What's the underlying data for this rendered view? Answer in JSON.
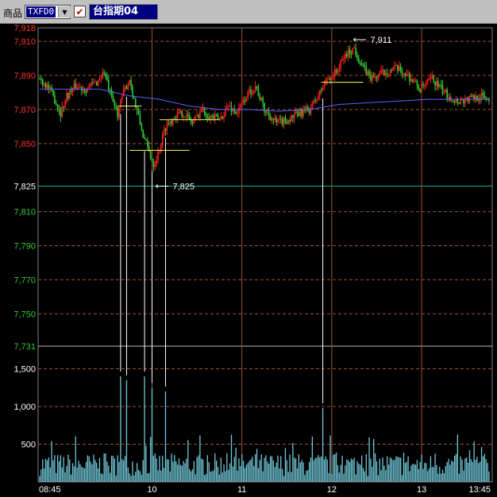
{
  "toolbar": {
    "product_label": "商品",
    "product_code": "TXFD0",
    "dropdown_glyph": "▼",
    "check_glyph": "✔",
    "instrument_name": "台指期04"
  },
  "colors": {
    "background": "#000000",
    "grid": "#a0522d",
    "up": "#ff2020",
    "down": "#33cc33",
    "avg_line": "#6060ff",
    "volume": "#70c8d8",
    "price_tick_upper": "#ff3030",
    "price_tick_lower": "#33cc33",
    "neutral_tick": "#ffffff",
    "annotation": "#ffffff",
    "yellow_marks": "#ffff66"
  },
  "chart_data": {
    "type": "candlestick_with_volume",
    "x_tick_labels": [
      "08:45",
      "10",
      "11",
      "12",
      "13",
      "13:45"
    ],
    "price_axis": {
      "ylim": [
        7731,
        7918
      ],
      "ticks": [
        {
          "value": 7918,
          "label": "7,918",
          "color": "up"
        },
        {
          "value": 7910,
          "label": "7,910",
          "color": "up"
        },
        {
          "value": 7890,
          "label": "7,890",
          "color": "up"
        },
        {
          "value": 7870,
          "label": "7,870",
          "color": "up"
        },
        {
          "value": 7850,
          "label": "7,850",
          "color": "up"
        },
        {
          "value": 7825,
          "label": "7,825",
          "color": "neutral"
        },
        {
          "value": 7810,
          "label": "7,810",
          "color": "down"
        },
        {
          "value": 7790,
          "label": "7,790",
          "color": "down"
        },
        {
          "value": 7770,
          "label": "7,770",
          "color": "down"
        },
        {
          "value": 7750,
          "label": "7,750",
          "color": "down"
        },
        {
          "value": 7731,
          "label": "7,731",
          "color": "down"
        }
      ],
      "reference_price": 7825
    },
    "volume_axis": {
      "ylim": [
        0,
        1800
      ],
      "ticks": [
        {
          "value": 1500,
          "label": "1,500"
        },
        {
          "value": 1000,
          "label": "1,000"
        },
        {
          "value": 500,
          "label": "500"
        }
      ]
    },
    "annotations": [
      {
        "label": "7,911",
        "value": 7911,
        "time_min": 207
      },
      {
        "label": "7,825",
        "value": 7825,
        "time_min": 75
      }
    ],
    "session_minutes": 300,
    "price_anchors": [
      [
        0,
        7888
      ],
      [
        5,
        7884
      ],
      [
        10,
        7876
      ],
      [
        14,
        7868
      ],
      [
        18,
        7878
      ],
      [
        24,
        7884
      ],
      [
        30,
        7882
      ],
      [
        38,
        7886
      ],
      [
        43,
        7892
      ],
      [
        48,
        7876
      ],
      [
        52,
        7868
      ],
      [
        56,
        7880
      ],
      [
        60,
        7888
      ],
      [
        64,
        7872
      ],
      [
        67,
        7862
      ],
      [
        70,
        7852
      ],
      [
        73,
        7845
      ],
      [
        76,
        7838
      ],
      [
        79,
        7844
      ],
      [
        84,
        7860
      ],
      [
        90,
        7866
      ],
      [
        96,
        7868
      ],
      [
        102,
        7862
      ],
      [
        108,
        7870
      ],
      [
        114,
        7866
      ],
      [
        120,
        7864
      ],
      [
        126,
        7872
      ],
      [
        132,
        7868
      ],
      [
        138,
        7878
      ],
      [
        144,
        7884
      ],
      [
        150,
        7870
      ],
      [
        158,
        7862
      ],
      [
        166,
        7864
      ],
      [
        174,
        7868
      ],
      [
        180,
        7870
      ],
      [
        186,
        7878
      ],
      [
        192,
        7888
      ],
      [
        198,
        7892
      ],
      [
        204,
        7902
      ],
      [
        210,
        7906
      ],
      [
        216,
        7894
      ],
      [
        222,
        7888
      ],
      [
        230,
        7892
      ],
      [
        238,
        7894
      ],
      [
        246,
        7890
      ],
      [
        254,
        7882
      ],
      [
        262,
        7888
      ],
      [
        270,
        7880
      ],
      [
        278,
        7875
      ],
      [
        286,
        7876
      ],
      [
        294,
        7878
      ],
      [
        300,
        7876
      ]
    ],
    "avg_anchors": [
      [
        0,
        7882
      ],
      [
        20,
        7882
      ],
      [
        40,
        7882
      ],
      [
        60,
        7878
      ],
      [
        80,
        7876
      ],
      [
        100,
        7872
      ],
      [
        120,
        7870
      ],
      [
        140,
        7870
      ],
      [
        160,
        7869
      ],
      [
        180,
        7870
      ],
      [
        200,
        7873
      ],
      [
        220,
        7874
      ],
      [
        240,
        7875
      ],
      [
        260,
        7876
      ],
      [
        280,
        7876
      ],
      [
        300,
        7876
      ]
    ],
    "volume_spikes": [
      {
        "time_min": 54,
        "value": 1400
      },
      {
        "time_min": 58,
        "value": 1350
      },
      {
        "time_min": 70,
        "value": 1400
      },
      {
        "time_min": 75,
        "value": 1250
      },
      {
        "time_min": 84,
        "value": 1200
      },
      {
        "time_min": 189,
        "value": 980
      }
    ],
    "yellow_marks": [
      {
        "time_start_min": 60,
        "time_end_min": 100,
        "value": 7846
      },
      {
        "time_start_min": 80,
        "time_end_min": 120,
        "value": 7864
      },
      {
        "time_start_min": 52,
        "time_end_min": 68,
        "value": 7872
      },
      {
        "time_start_min": 188,
        "time_end_min": 216,
        "value": 7886
      }
    ]
  }
}
